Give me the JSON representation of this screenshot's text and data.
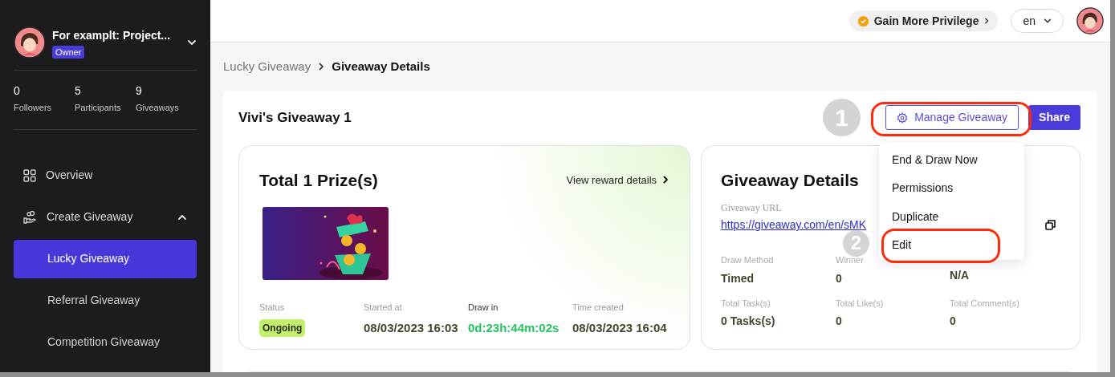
{
  "sidebar": {
    "account": {
      "name": "For examplt: Project...",
      "role": "Owner"
    },
    "stats": [
      {
        "value": "0",
        "label": "Followers"
      },
      {
        "value": "5",
        "label": "Participants"
      },
      {
        "value": "9",
        "label": "Giveaways"
      }
    ],
    "nav": [
      {
        "label": "Overview",
        "selected": false
      },
      {
        "label": "Create Giveaway",
        "selected": false,
        "expanded": true,
        "children": [
          {
            "label": "Lucky Giveaway",
            "selected": true
          },
          {
            "label": "Referral Giveaway",
            "selected": false
          },
          {
            "label": "Competition Giveaway",
            "selected": false
          }
        ]
      }
    ]
  },
  "topbar": {
    "privilege": "Gain More Privilege",
    "language": "en"
  },
  "breadcrumb": [
    "Lucky Giveaway",
    "Giveaway Details"
  ],
  "giveaway": {
    "title": "Vivi's Giveaway 1",
    "manage_button": {
      "label": "Manage Giveaway",
      "highlighted": true
    },
    "share_button": "Share",
    "menu": [
      {
        "label": "End & Draw Now",
        "highlighted": false
      },
      {
        "label": "Permissions",
        "highlighted": false
      },
      {
        "label": "Duplicate",
        "highlighted": false
      },
      {
        "label": "Edit",
        "highlighted": true
      }
    ],
    "prize_card": {
      "title": "Total 1 Prize(s)",
      "link": "View reward details",
      "fields": [
        {
          "label": "Status",
          "value": "Ongoing",
          "kind": "badge"
        },
        {
          "label": "Started at",
          "value": "08/03/2023 16:03",
          "kind": "text"
        },
        {
          "label": "Draw in",
          "value": "0d:23h:44m:02s",
          "kind": "countdown"
        },
        {
          "label": "Time created",
          "value": "08/03/2023 16:04",
          "kind": "text"
        }
      ]
    },
    "details_card": {
      "title": "Giveaway Details",
      "url_label": "Giveaway URL",
      "url": "https://giveaway.com/en/sMK",
      "fields": [
        {
          "label": "Draw Method",
          "value": "Timed"
        },
        {
          "label": "Winner",
          "value": "0"
        },
        {
          "value": "N/A"
        },
        {
          "label": "Total Task(s)",
          "value": "0 Tasks(s)"
        },
        {
          "label": "Total Like(s)",
          "value": "0"
        },
        {
          "label": "Total Comment(s)",
          "value": "0"
        }
      ]
    }
  },
  "annotations": [
    {
      "label": "1"
    },
    {
      "label": "2"
    }
  ]
}
